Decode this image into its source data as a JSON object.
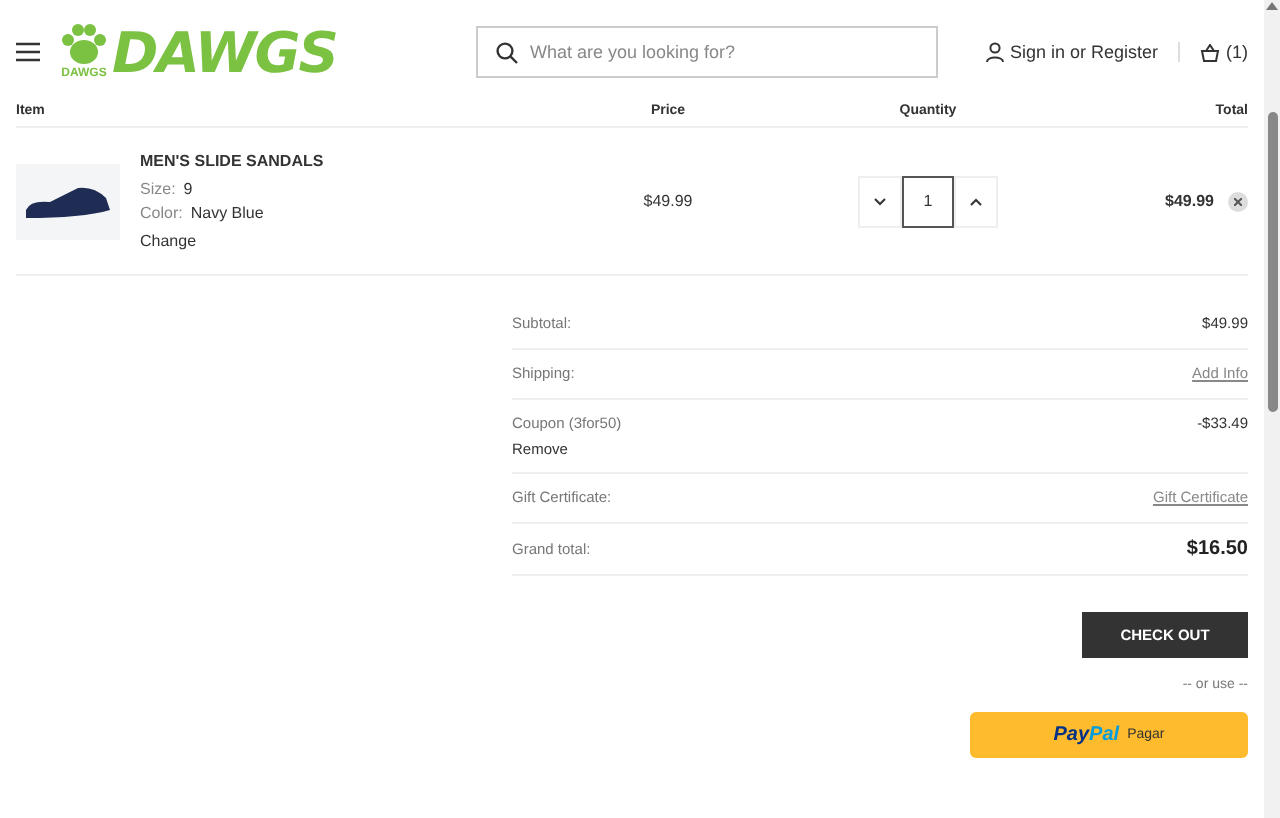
{
  "header": {
    "logo_text": "DAWGS",
    "paw_text": "DAWGS",
    "search": {
      "placeholder": "What are you looking for?"
    },
    "account": "Sign in or Register",
    "cart_count": "(1)"
  },
  "columns": [
    "Item",
    "Price",
    "Quantity",
    "Total"
  ],
  "items": [
    {
      "name": "MEN'S SLIDE SANDALS",
      "options": [
        {
          "label": "Size:",
          "value": "9"
        },
        {
          "label": "Color:",
          "value": "Navy Blue"
        }
      ],
      "change": "Change",
      "price": "$49.99",
      "quantity": "1",
      "total": "$49.99"
    }
  ],
  "summary": [
    {
      "kind": "plain",
      "label": "Subtotal:",
      "value": "$49.99"
    },
    {
      "kind": "link",
      "label": "Shipping:",
      "value": "Add Info"
    },
    {
      "kind": "coupon",
      "label": "Coupon (3for50)",
      "action": "Remove",
      "value": "-$33.49"
    },
    {
      "kind": "link",
      "label": "Gift Certificate:",
      "value": "Gift Certificate"
    },
    {
      "kind": "grand",
      "label": "Grand total:",
      "value": "$16.50"
    }
  ],
  "checkout": "CHECK OUT",
  "or_use": "-- or use --",
  "paypal": {
    "logo": [
      "Pay",
      "Pal"
    ],
    "label": "Pagar"
  }
}
